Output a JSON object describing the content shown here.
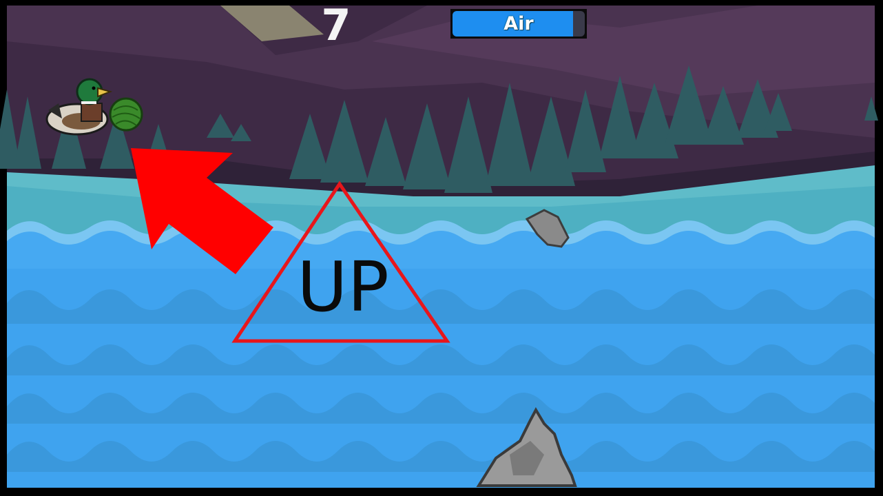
{
  "hud": {
    "score": "7",
    "air_label": "Air",
    "air_level": 0.91,
    "air_color": "#1e8ef0"
  },
  "overlay": {
    "hint_text": "UP",
    "hint_shape_color": "#e8161b",
    "arrow_color": "#ff0000"
  },
  "scene": {
    "player": "duck-icon",
    "projectile": "yarn-ball-icon",
    "obstacles": [
      "rock-icon",
      "rock-icon"
    ],
    "sky_color": "#4a3150",
    "water_color": "#3fa3ef"
  }
}
